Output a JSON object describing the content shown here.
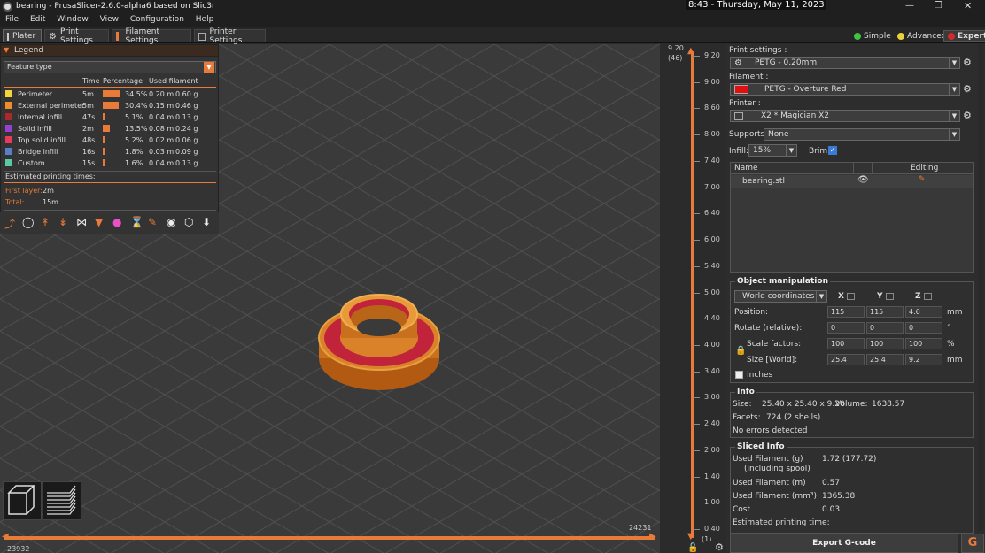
{
  "window": {
    "title": "bearing - PrusaSlicer-2.6.0-alpha6 based on Slic3r",
    "clock": "8:43 - Thursday, May 11, 2023"
  },
  "menu": [
    "File",
    "Edit",
    "Window",
    "View",
    "Configuration",
    "Help"
  ],
  "tabs": [
    "Plater",
    "Print Settings",
    "Filament Settings",
    "Printer Settings"
  ],
  "modes": [
    {
      "label": "Simple",
      "color": "#3ec43e"
    },
    {
      "label": "Advanced",
      "color": "#e8d23a"
    },
    {
      "label": "Expert",
      "color": "#d62828"
    }
  ],
  "legend": {
    "title": "Legend",
    "view_type": "Feature type",
    "headers": {
      "time": "Time",
      "percentage": "Percentage",
      "used": "Used filament"
    },
    "rows": [
      {
        "name": "Perimeter",
        "time": "5m",
        "pct": "34.5%",
        "pct_val": 34.5,
        "m": "0.20 m",
        "g": "0.60 g",
        "color": "#f3d43a"
      },
      {
        "name": "External perimeter",
        "time": "5m",
        "pct": "30.4%",
        "pct_val": 30.4,
        "m": "0.15 m",
        "g": "0.46 g",
        "color": "#f28a2a"
      },
      {
        "name": "Internal infill",
        "time": "47s",
        "pct": "5.1%",
        "pct_val": 5.1,
        "m": "0.04 m",
        "g": "0.13 g",
        "color": "#a82a2a"
      },
      {
        "name": "Solid infill",
        "time": "2m",
        "pct": "13.5%",
        "pct_val": 13.5,
        "m": "0.08 m",
        "g": "0.24 g",
        "color": "#9b3fd1"
      },
      {
        "name": "Top solid infill",
        "time": "48s",
        "pct": "5.2%",
        "pct_val": 5.2,
        "m": "0.02 m",
        "g": "0.06 g",
        "color": "#e83a5a"
      },
      {
        "name": "Bridge infill",
        "time": "16s",
        "pct": "1.8%",
        "pct_val": 1.8,
        "m": "0.03 m",
        "g": "0.09 g",
        "color": "#5a7fc8"
      },
      {
        "name": "Custom",
        "time": "15s",
        "pct": "1.6%",
        "pct_val": 1.6,
        "m": "0.04 m",
        "g": "0.13 g",
        "color": "#5ac8a0"
      }
    ],
    "est_title": "Estimated printing times:",
    "first_layer_label": "First layer:",
    "first_layer": "2m",
    "total_label": "Total:",
    "total": "15m"
  },
  "hslider": {
    "left": "23932",
    "right": "24231"
  },
  "vslider": {
    "top_value": "9.20",
    "top_layer": "(46)",
    "bottom_value": "0.40",
    "bottom_layer": "(1)",
    "ticks": [
      "9.20",
      "9.00",
      "8.60",
      "8.00",
      "7.40",
      "7.00",
      "6.40",
      "6.00",
      "5.40",
      "5.00",
      "4.40",
      "4.00",
      "3.40",
      "3.00",
      "2.40",
      "2.00",
      "1.40",
      "1.00",
      "0.40"
    ]
  },
  "sidebar": {
    "print_settings_label": "Print settings :",
    "print_settings": "PETG - 0.20mm",
    "filament_label": "Filament :",
    "filament": "PETG - Overture Red",
    "filament_color": "#e01010",
    "printer_label": "Printer :",
    "printer": "X2 * Magician X2",
    "supports_label": "Supports:",
    "supports": "None",
    "infill_label": "Infill:",
    "infill": "15%",
    "brim_label": "Brim:",
    "object_list": {
      "col_name": "Name",
      "col_editing": "Editing",
      "items": [
        "bearing.stl"
      ]
    },
    "object_manipulation": {
      "title": "Object manipulation",
      "coords": "World coordinates",
      "x_label": "X",
      "y_label": "Y",
      "z_label": "Z",
      "position_label": "Position:",
      "position": [
        "115",
        "115",
        "4.6"
      ],
      "position_unit": "mm",
      "rotate_label": "Rotate (relative):",
      "rotate": [
        "0",
        "0",
        "0"
      ],
      "rotate_unit": "°",
      "scale_label": "Scale factors:",
      "scale": [
        "100",
        "100",
        "100"
      ],
      "scale_unit": "%",
      "size_label": "Size [World]:",
      "size": [
        "25.4",
        "25.4",
        "9.2"
      ],
      "size_unit": "mm",
      "inches_label": "Inches"
    },
    "info": {
      "title": "Info",
      "size_label": "Size:",
      "size": "25.40 x 25.40 x 9.20",
      "volume_label": "Volume:",
      "volume": "1638.57",
      "facets_label": "Facets:",
      "facets": "724 (2 shells)",
      "errors": "No errors detected"
    },
    "sliced": {
      "title": "Sliced Info",
      "used_g_label": "Used Filament (g)",
      "used_g_sub": "(including spool)",
      "used_g": "1.72 (177.72)",
      "used_m_label": "Used Filament (m)",
      "used_m": "0.57",
      "used_mm3_label": "Used Filament (mm³)",
      "used_mm3": "1365.38",
      "cost_label": "Cost",
      "cost": "0.03",
      "est_label": "Estimated printing time:"
    },
    "export_button": "Export G-code"
  }
}
